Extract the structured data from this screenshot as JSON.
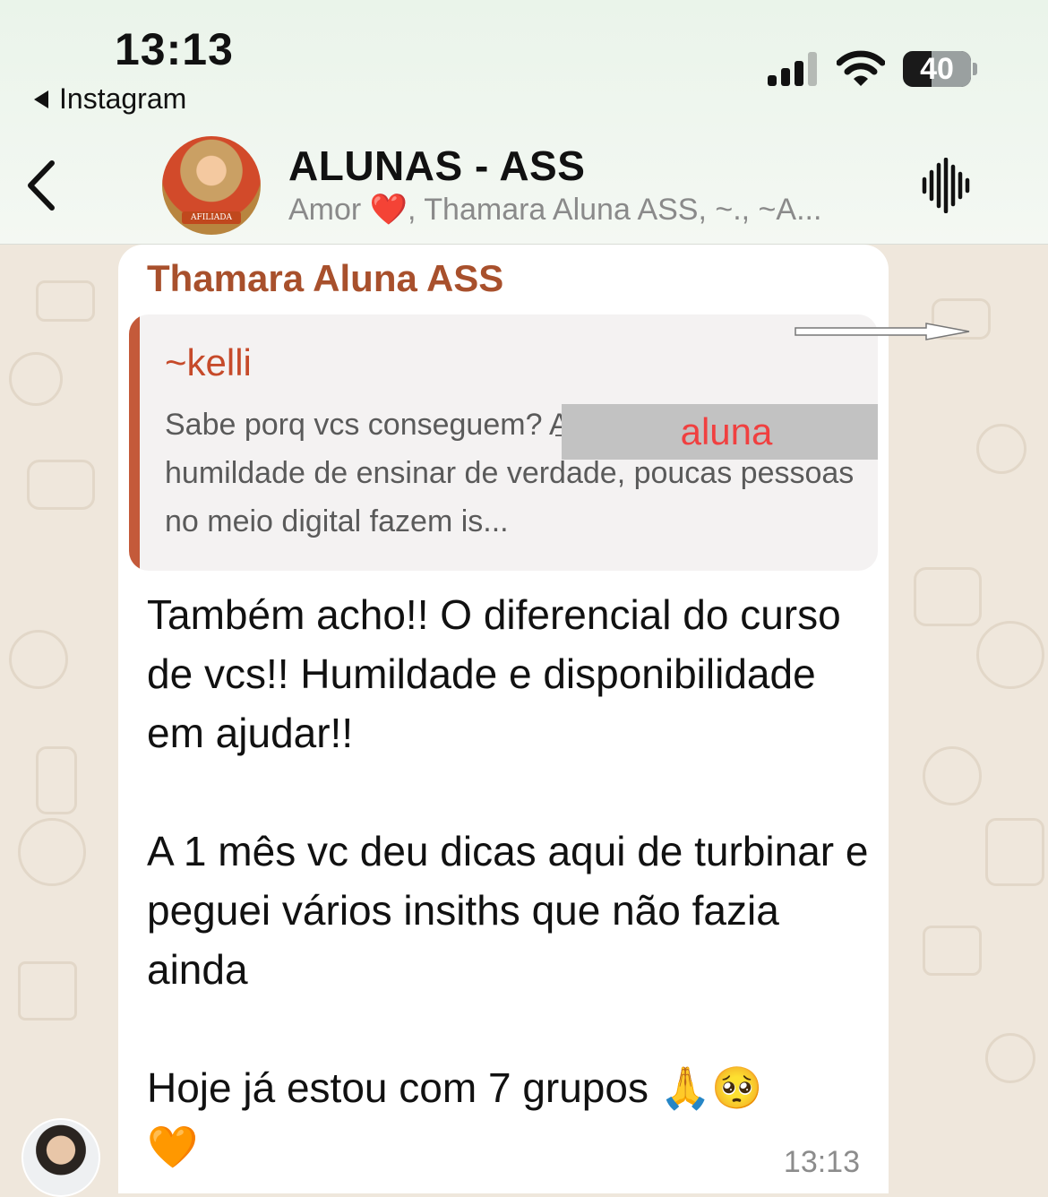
{
  "status_bar": {
    "time": "13:13",
    "back_app": "Instagram",
    "battery": "40"
  },
  "header": {
    "title": "ALUNAS - ASS",
    "subtitle": "Amor ❤️, Thamara Aluna ASS, ~., ~A..."
  },
  "message": {
    "sender": "Thamara Aluna ASS",
    "quote": {
      "author": "~kelli",
      "redacted_label": "aluna",
      "text": "Sabe porq vcs conseguem? A verdade é, vcs tem humildade de ensinar de verdade, poucas pessoas no meio digital fazem is..."
    },
    "text": "Também acho!! O diferencial do curso de vcs!! Humildade e disponibilidade em ajudar!!\n\nA 1 mês vc deu dicas aqui de turbinar e peguei vários insiths que não fazia ainda\n\nHoje já estou com 7 grupos 🙏🥺\n🧡",
    "time": "13:13"
  },
  "icons": {
    "back": "chevron-left-icon",
    "signal": "cellular-signal-icon",
    "wifi": "wifi-icon",
    "voice": "audio-waveform-icon"
  },
  "colors": {
    "sender_name": "#a8502c",
    "quote_bar": "#c45a3a",
    "redaction_text": "#f04040"
  }
}
